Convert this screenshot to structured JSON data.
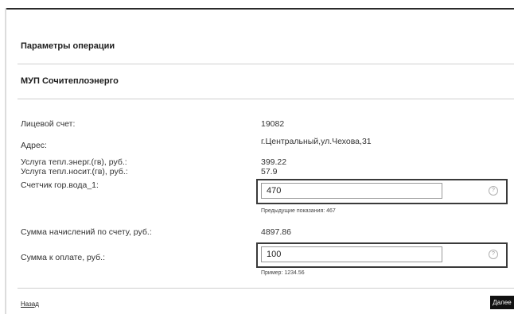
{
  "panel": {
    "title": "Параметры операции",
    "organization": "МУП Сочитеплоэнерго"
  },
  "fields": {
    "account_label": "Лицевой счет:",
    "account_value": "19082",
    "address_label": "Адрес:",
    "address_value": "г.Центральный,ул.Чехова,31",
    "heat_energy_label": "Услуга тепл.энерг.(гв), руб.:",
    "heat_energy_value": "399.22",
    "heat_carrier_label": "Услуга тепл.носит.(гв), руб.:",
    "heat_carrier_value": "57.9",
    "meter_label": "Счетчик гор.вода_1:",
    "meter_value": "470",
    "meter_hint": "Предыдущие показания: 467",
    "charges_label": "Сумма начислений по счету, руб.:",
    "charges_value": "4897.86",
    "payment_label": "Сумма к оплате, руб.:",
    "payment_value": "100",
    "payment_hint": "Пример: 1234.56"
  },
  "nav": {
    "back_label": "Назад",
    "next_label": "Далее"
  },
  "icons": {
    "help": "help-circle-icon"
  }
}
